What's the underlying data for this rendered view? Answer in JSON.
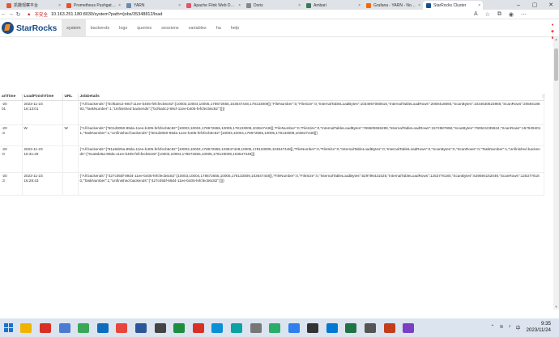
{
  "browser": {
    "tabs": [
      {
        "label": "凯撒观察平台",
        "color": "#e05a3a"
      },
      {
        "label": "Prometheus Pushgateway",
        "color": "#e6522c"
      },
      {
        "label": "YARN",
        "color": "#6a8caf"
      },
      {
        "label": "Apache Flink Web Dashboard",
        "color": "#e6526f"
      },
      {
        "label": "Doris",
        "color": "#888888"
      },
      {
        "label": "Ambari",
        "color": "#3b7a57"
      },
      {
        "label": "Grafana - YARN - NodeManager",
        "color": "#f46800"
      },
      {
        "label": "StarRocks Cluster",
        "color": "#1b4f8a",
        "active": true
      }
    ],
    "window_controls": [
      "–",
      "▢",
      "✕"
    ],
    "address": {
      "security_label": "不安全",
      "url": "10.163.251.180:8030/system?path=/jobs/35348812/load"
    }
  },
  "app": {
    "logo_text": "StarRocks",
    "menu": [
      "system",
      "backends",
      "logs",
      "queries",
      "sessions",
      "variables",
      "ha",
      "help"
    ],
    "active_menu": "system"
  },
  "table": {
    "columns": [
      "artTime",
      "LoadFinishTime",
      "URL",
      "JobDetails"
    ],
    "rows": [
      {
        "start": "-20\n01",
        "finish": "2023-11-23\n16:13:01",
        "url": "",
        "details": "{\"All backends\":{\"bcf6a0c2-89cf-11ee-b405-fefcfecb6c82\":[10003,10004,10005,178672655,103647448,178133009]},\"FileNumber\":0,\"FileSize\":0,\"InternalTableLoadBytes\":1034967080616,\"InternalTableLoadRows\":2059418693,\"ScanBytes\":1034630623966,\"ScanRows\":2059418693,\"TaskNumber\":1,\"Unfinished backends\":{\"bcf6a0c2-89cf-11ee-b405-fefcfecb6c82\":[]}}"
      },
      {
        "start": "-20\n:3",
        "finish": "W",
        "url": "W",
        "details": "{\"All backends\":{\"501d3050-89da-11ee-b405-fefcfecb6c82\":[10003,10004,178672655,10005,178133009,103647448]},\"FileNumber\":0,\"FileSize\":0,\"InternalTableLoadBytes\":769600655289,\"InternalTableLoadRows\":1572987958,\"ScanBytes\":790521039524,\"ScanRows\":1575294011,\"TaskNumber\":1,\"Unfinished backends\":{\"501d3050-89da-11ee-b405-fefcfecb6c82\":[10003,10004,178672655,10005,178133009,103647448]}}"
      },
      {
        "start": "-20\n:0",
        "finish": "2023-11-23\n16:31:29",
        "url": "",
        "details": "{\"All backends\":{\"91a8d25a-89da-11ee-b405-fefcfecb6c82\":[10003,10004,178672655,103647448,10005,178133009,103647448]},\"FileNumber\":0,\"FileSize\":0,\"InternalTableLoadBytes\":0,\"InternalTableLoadRows\":0,\"ScanBytes\":0,\"ScanRows\":0,\"TaskNumber\":1,\"Unfinished backends\":{\"91a8d25a-89da-11ee-b405-fefcfecb6c82\":[10003,10004,178672655,10005,178133009,103647448]}}"
      },
      {
        "start": "-20\n:3",
        "finish": "2023-11-23\n16:28:43",
        "url": "",
        "details": "{\"All backends\":{\"427c055f-89d4-11ee-b405-fefcfecb6c82\":[10003,10004,178672655,10005,178133009,103647448]},\"FileNumber\":0,\"FileSize\":0,\"InternalTableLoadBytes\":629796431025,\"InternalTableLoadRows\":1253776180,\"ScanBytes\":629594162049,\"ScanRows\":1253776180,\"TaskNumber\":1,\"Unfinished backends\":{\"427c055f-89d4-11ee-b405-fefcfecb6c82\":[]}}"
      }
    ]
  },
  "taskbar": {
    "apps": [
      {
        "name": "start-menu",
        "color": "#1a73c8"
      },
      {
        "name": "file-explorer",
        "color": "#f0b400"
      },
      {
        "name": "youdao",
        "color": "#d93025"
      },
      {
        "name": "notepad",
        "color": "#4a7bd0"
      },
      {
        "name": "green-app",
        "color": "#3aa757"
      },
      {
        "name": "outlook",
        "color": "#0f6cbd"
      },
      {
        "name": "chrome",
        "color": "#e8453c"
      },
      {
        "name": "word",
        "color": "#2b579a"
      },
      {
        "name": "dark-app",
        "color": "#444444"
      },
      {
        "name": "green-app-2",
        "color": "#1e8e3e"
      },
      {
        "name": "red-app",
        "color": "#d93025"
      },
      {
        "name": "edge",
        "color": "#0c8fd6"
      },
      {
        "name": "teal-app",
        "color": "#0aa2a2"
      },
      {
        "name": "gray-app",
        "color": "#777777"
      },
      {
        "name": "wechat",
        "color": "#2aae67"
      },
      {
        "name": "search-app",
        "color": "#2f80ed"
      },
      {
        "name": "dark-app-2",
        "color": "#333333"
      },
      {
        "name": "blue-app",
        "color": "#0078d4"
      },
      {
        "name": "excel",
        "color": "#217346"
      },
      {
        "name": "screen-app",
        "color": "#555555"
      },
      {
        "name": "powerpoint",
        "color": "#c43e1c"
      },
      {
        "name": "purple-app",
        "color": "#7b3fc4"
      }
    ],
    "time": "9:35",
    "date": "2023/11/24"
  }
}
